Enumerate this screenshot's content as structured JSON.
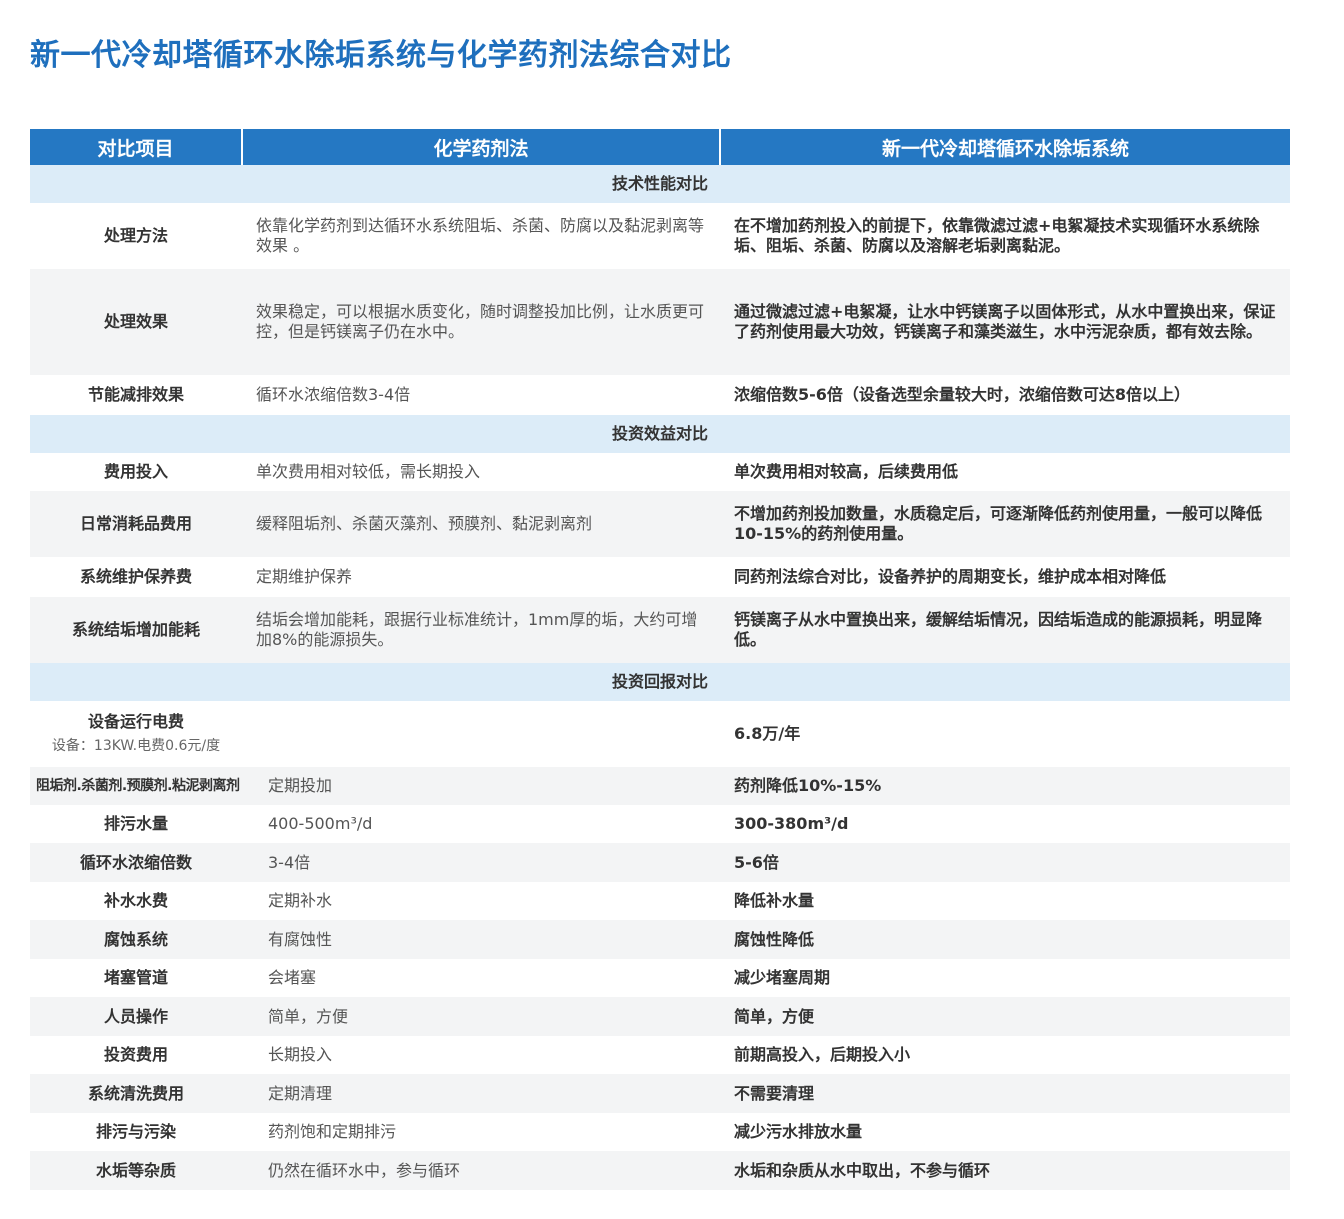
{
  "title": "新一代冷却塔循环水除垢系统与化学药剂法综合对比",
  "headers": [
    "对比项目",
    "化学药剂法",
    "新一代冷却塔循环水除垢系统"
  ],
  "sections": {
    "tech": "技术性能对比",
    "invest": "投资效益对比",
    "roi": "投资回报对比"
  },
  "tech_rows": [
    {
      "item": "处理方法",
      "chem": "依靠化学药剂到达循环水系统阻垢、杀菌、防腐以及黏泥剥离等效果 。",
      "new": "在不增加药剂投入的前提下，依靠微滤过滤+电絮凝技术实现循环水系统除垢、阻垢、杀菌、防腐以及溶解老垢剥离黏泥。"
    },
    {
      "item": "处理效果",
      "chem": "效果稳定，可以根据水质变化，随时调整投加比例，让水质更可控，但是钙镁离子仍在水中。",
      "new": "通过微滤过滤+电絮凝，让水中钙镁离子以固体形式，从水中置换出来，保证了药剂使用最大功效，钙镁离子和藻类滋生，水中污泥杂质，都有效去除。"
    },
    {
      "item": "节能减排效果",
      "chem": "循环水浓缩倍数3-4倍",
      "new": "浓缩倍数5-6倍（设备选型余量较大时，浓缩倍数可达8倍以上）"
    }
  ],
  "invest_rows": [
    {
      "item": "费用投入",
      "chem": "单次费用相对较低，需长期投入",
      "new": "单次费用相对较高，后续费用低"
    },
    {
      "item": "日常消耗品费用",
      "chem": "缓释阻垢剂、杀菌灭藻剂、预膜剂、黏泥剥离剂",
      "new": "不增加药剂投加数量，水质稳定后，可逐渐降低药剂使用量，一般可以降低10-15%的药剂使用量。"
    },
    {
      "item": "系统维护保养费",
      "chem": "定期维护保养",
      "new": "同药剂法综合对比，设备养护的周期变长，维护成本相对降低"
    },
    {
      "item": "系统结垢增加能耗",
      "chem": "结垢会增加能耗，跟据行业标准统计，1mm厚的垢，大约可增加8%的能源损失。",
      "new": "钙镁离子从水中置换出来，缓解结垢情况，因结垢造成的能源损耗，明显降低。"
    }
  ],
  "roi_power": {
    "item": "设备运行电费",
    "note": "设备：13KW.电费0.6元/度",
    "chem": "",
    "new": "6.8万/年"
  },
  "roi_rows": [
    {
      "item": "阻垢剂.杀菌剂.预膜剂.粘泥剥离剂",
      "chem": "定期投加",
      "new": "药剂降低10%-15%"
    },
    {
      "item": "排污水量",
      "chem": "400-500m³/d",
      "new": "300-380m³/d"
    },
    {
      "item": "循环水浓缩倍数",
      "chem": "3-4倍",
      "new": "5-6倍"
    },
    {
      "item": "补水水费",
      "chem": "定期补水",
      "new": "降低补水量"
    },
    {
      "item": "腐蚀系统",
      "chem": "有腐蚀性",
      "new": "腐蚀性降低"
    },
    {
      "item": "堵塞管道",
      "chem": "会堵塞",
      "new": "减少堵塞周期"
    },
    {
      "item": "人员操作",
      "chem": "简单，方便",
      "new": "简单，方便"
    },
    {
      "item": "投资费用",
      "chem": "长期投入",
      "new": "前期高投入，后期投入小"
    },
    {
      "item": "系统清洗费用",
      "chem": "定期清理",
      "new": "不需要清理"
    },
    {
      "item": "排污与污染",
      "chem": "药剂饱和定期排污",
      "new": "减少污水排放水量"
    },
    {
      "item": "水垢等杂质",
      "chem": "仍然在循环水中，参与循环",
      "new": "水垢和杂质从水中取出，不参与循环"
    }
  ]
}
